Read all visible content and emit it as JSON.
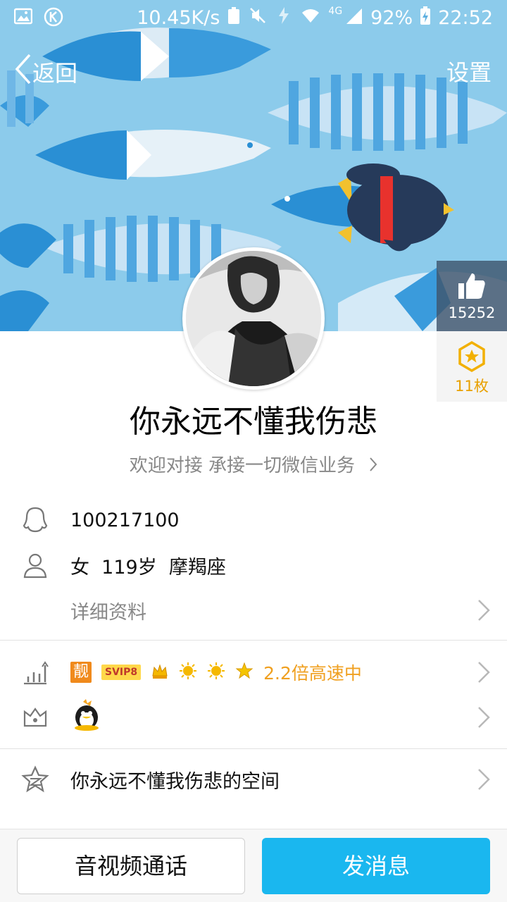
{
  "status_bar": {
    "net_speed": "10.45K/s",
    "network": "4G",
    "battery": "92%",
    "time": "22:52"
  },
  "nav": {
    "back_label": "返回",
    "settings_label": "设置"
  },
  "likes": {
    "count": "15252"
  },
  "medals": {
    "count": "11枚"
  },
  "profile": {
    "nickname": "你永远不懂我伤悲",
    "signature": "欢迎对接 承接一切微信业务"
  },
  "info": {
    "qq_number": "100217100",
    "gender_age_sign": "女  119岁  摩羯座",
    "details_label": "详细资料"
  },
  "badges": {
    "liang_label": "靓",
    "svip_label": "SVIP8",
    "speed_label": "2.2倍高速中"
  },
  "space": {
    "label": "你永远不懂我伤悲的空间"
  },
  "actions": {
    "call_label": "音视频通话",
    "message_label": "发消息"
  },
  "colors": {
    "accent": "#1ab7ef",
    "orange": "#f0a020",
    "cover_bg": "#8cc8ea"
  }
}
